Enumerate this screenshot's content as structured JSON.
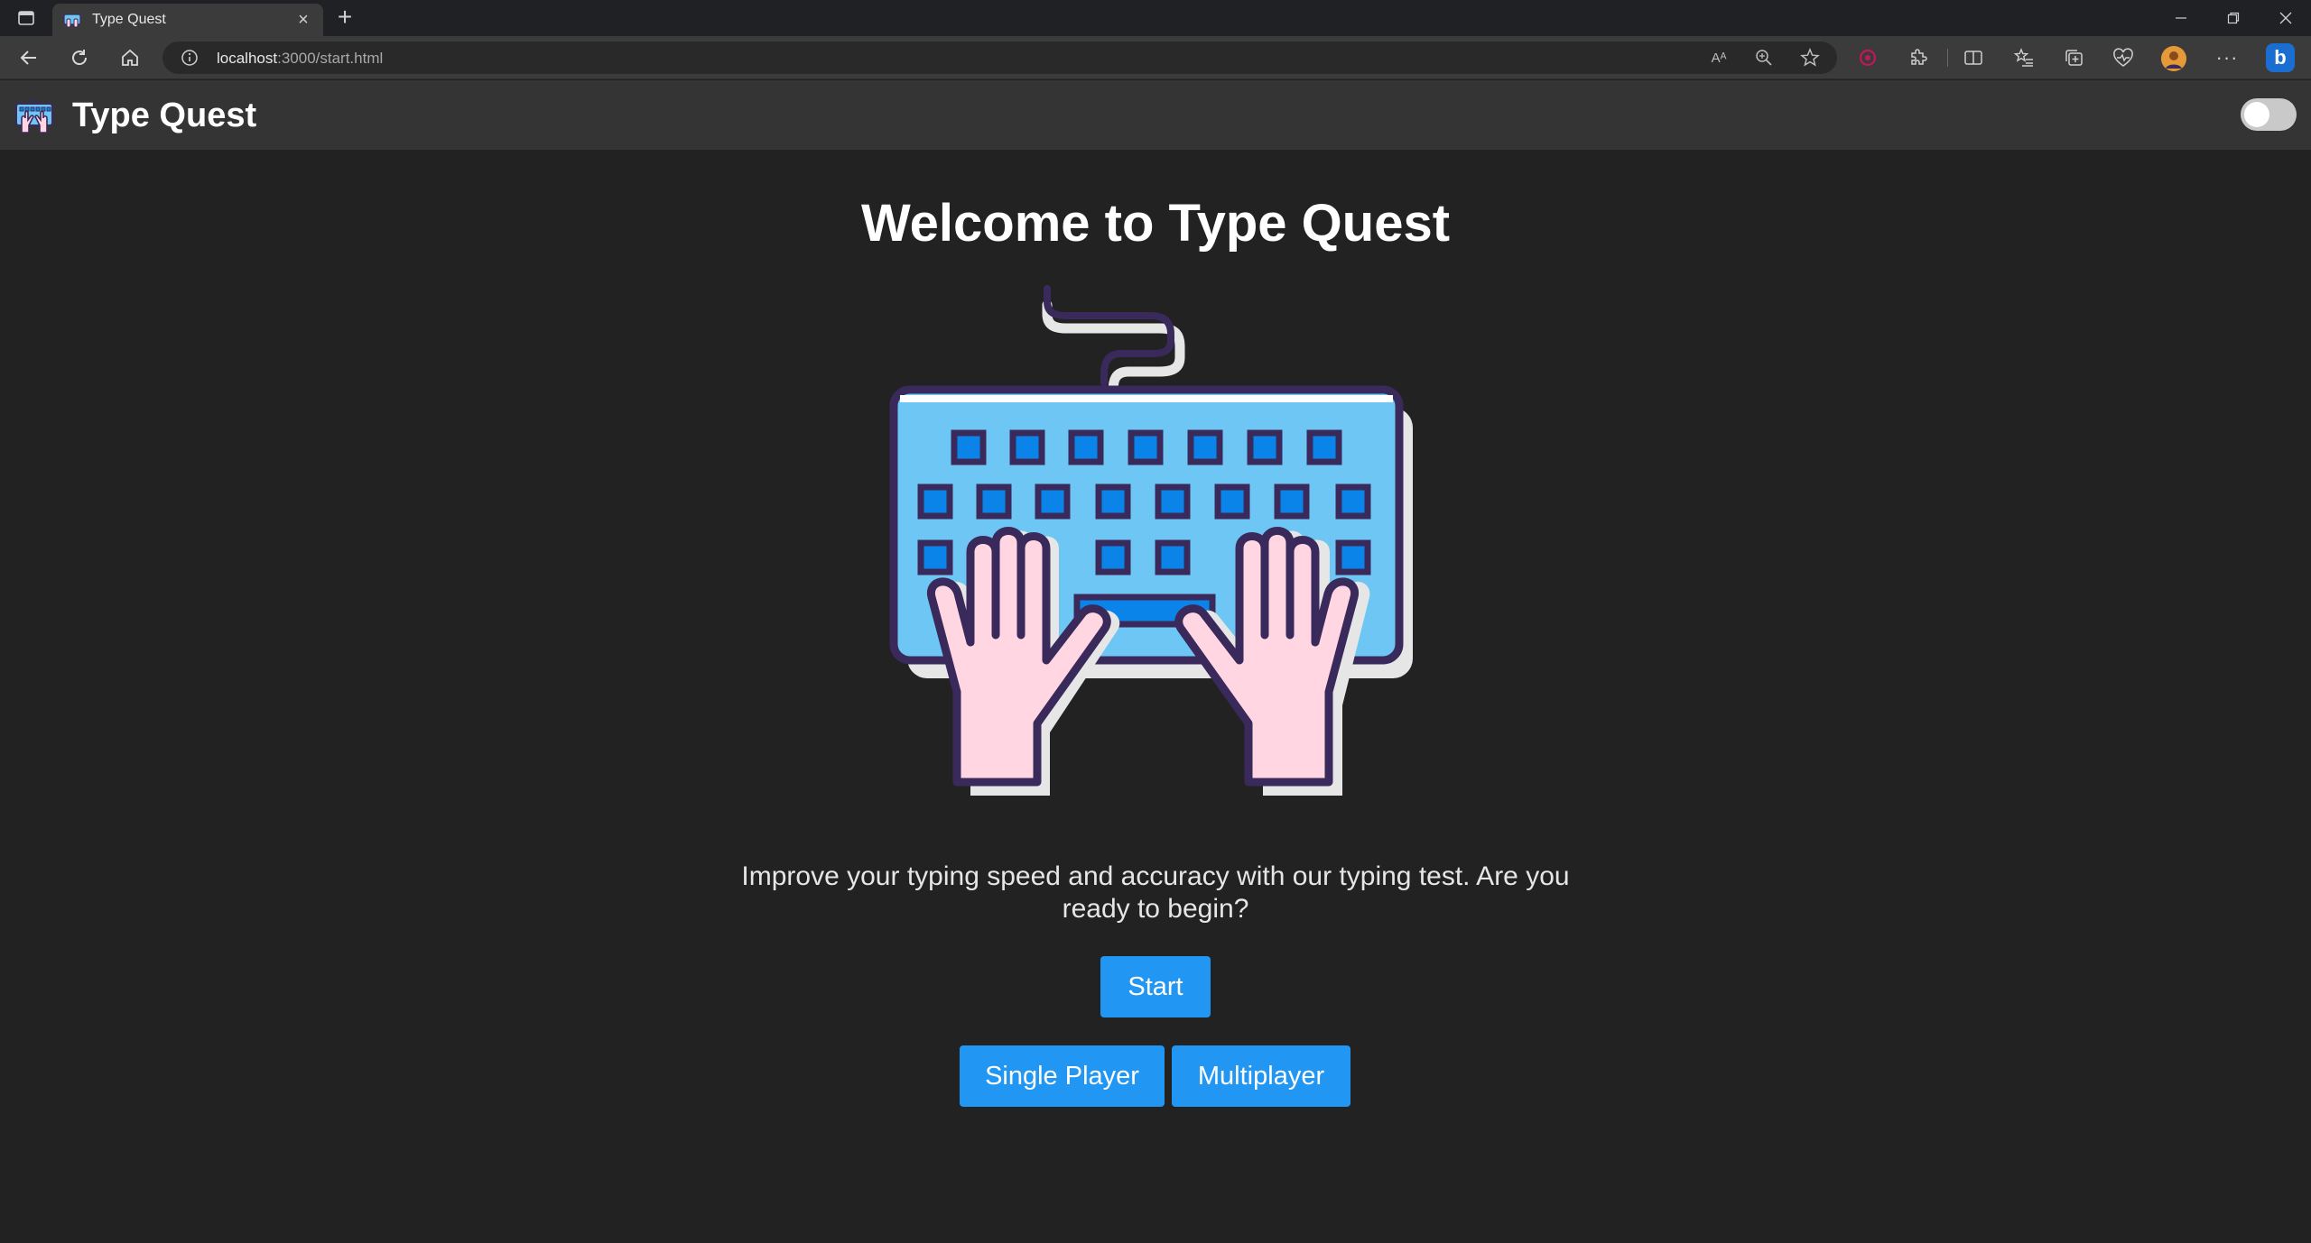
{
  "browser": {
    "tab_title": "Type Quest",
    "url_host": "localhost",
    "url_rest": ":3000/start.html",
    "read_aloud_label": "Aᴬ"
  },
  "header": {
    "title": "Type Quest",
    "theme_toggle_on": false
  },
  "main": {
    "heading": "Welcome to Type Quest",
    "tagline": "Improve your typing speed and accuracy with our typing test. Are you ready to begin?",
    "start_label": "Start",
    "single_player_label": "Single Player",
    "multiplayer_label": "Multiplayer"
  },
  "colors": {
    "page_bg": "#222222",
    "header_bg": "#343434",
    "button": "#2196f3",
    "keyboard_blue": "#6ec6f5",
    "key_blue": "#0a84e8",
    "outline": "#3a2a5c",
    "hand_pink": "#ffd6e2"
  }
}
